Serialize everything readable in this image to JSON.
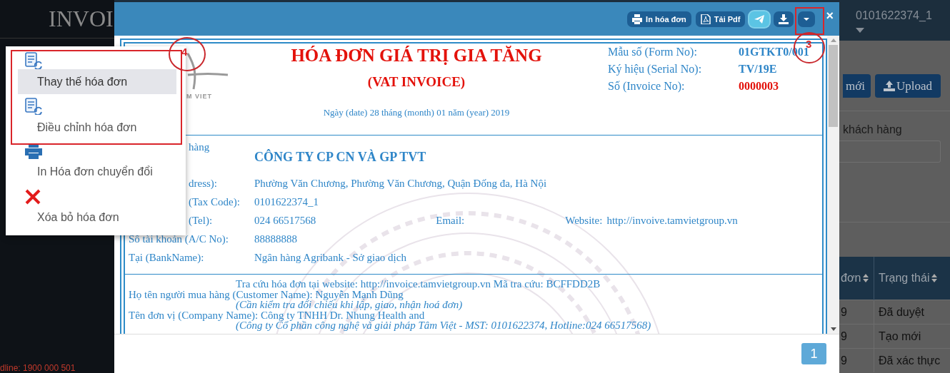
{
  "app": {
    "title": "INVOI",
    "user": "0101622374_1",
    "hotline": "dline: 1900 000 501",
    "toolbar_buttons": [
      {
        "label": "mới",
        "kind": "plain"
      },
      {
        "label": "Upload",
        "kind": "upload"
      }
    ],
    "search": {
      "label": "khách hàng"
    },
    "table": {
      "columns": [
        "đơn",
        "Trạng thái"
      ],
      "rows": [
        [
          "9",
          "Đã duyệt"
        ],
        [
          "9",
          "Tạo mới"
        ],
        [
          "9",
          "Đã xác thực"
        ]
      ]
    }
  },
  "modal": {
    "buttons": [
      {
        "label": "In hóa đơn",
        "kind": "print"
      },
      {
        "label": "Tải Pdf",
        "kind": "pdf"
      },
      {
        "kind": "send"
      },
      {
        "kind": "download"
      },
      {
        "kind": "caret"
      }
    ],
    "close": "×",
    "invoice": {
      "logo_text": "M VIET",
      "title": "HÓA ĐƠN GIÁ TRỊ GIA TĂNG",
      "subtitle": "(VAT INVOICE)",
      "meta": [
        {
          "label": "Mẫu số (Form No):",
          "value": "01GTKT0/001",
          "kind": "code"
        },
        {
          "label": "Ký hiệu (Serial No):",
          "value": "TV/19E",
          "kind": "code"
        },
        {
          "label": "Số (Invoice No):",
          "value": "0000003",
          "kind": "number"
        }
      ],
      "date": "Ngày (date) 28 tháng (month) 01 năm (year) 2019",
      "seller": [
        {
          "kind": "company",
          "label": "hàng",
          "value": "CÔNG TY CP CN VÀ GP TVT"
        },
        {
          "kind": "text",
          "label": "dress):",
          "value": "Phường Văn Chương, Phường Văn Chương, Quận Đống đa, Hà Nội"
        },
        {
          "kind": "text",
          "label": "(Tax Code):",
          "value": "0101622374_1"
        },
        {
          "kind": "contact",
          "label": "(Tel):",
          "value": "024 66517568",
          "email_label": "Email:",
          "website_label": "Website:",
          "website": "http://invoive.tamvietgroup.vn"
        },
        {
          "kind": "text",
          "label": "Số tài khoản (A/C No):",
          "value": "88888888"
        },
        {
          "kind": "text",
          "label": "Tại (BankName):",
          "value": "Ngân hàng Agribank - Sở giao dịch"
        }
      ],
      "lines": [
        {
          "kind": "lookup",
          "text": "Tra cứu hóa đơn tại website: http://invoice.tamvietgroup.vn   Mã tra cứu: BCFFDD2B"
        },
        {
          "kind": "buyer",
          "text": "Họ tên người mua hàng (Customer Name): Nguyễn Mạnh Dũng"
        },
        {
          "kind": "note",
          "text": "(Cần kiểm tra đối chiếu khi lập, giao, nhận hoá đơn)"
        },
        {
          "kind": "buyer",
          "text": "Tên đơn vị (Company Name): Công ty TNHH Dr. Nhung Health and"
        },
        {
          "kind": "note",
          "text": "(Công ty Cổ phần công nghệ và giải pháp Tâm Việt - MST: 0101622374, Hotline:024 66517568)"
        }
      ]
    },
    "pages": [
      {
        "label": "1",
        "selected": true
      }
    ]
  },
  "menu": {
    "items": [
      {
        "label": "Thay thế hóa đơn",
        "kind": "replace",
        "selected": true
      },
      {
        "label": "Điều chỉnh hóa đơn",
        "kind": "adjust",
        "selected": false
      },
      {
        "label": "In Hóa đơn chuyển đổi",
        "kind": "print",
        "selected": false
      },
      {
        "label": "Xóa bỏ hóa đơn",
        "kind": "delete",
        "selected": false
      }
    ]
  },
  "annotations": [
    {
      "number": "4"
    },
    {
      "number": "3"
    }
  ]
}
